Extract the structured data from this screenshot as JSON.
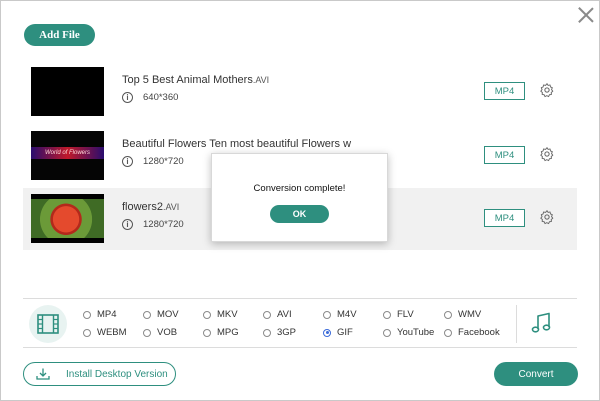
{
  "window": {
    "close_icon": "close-icon"
  },
  "toolbar": {
    "add_file_label": "Add File"
  },
  "files": [
    {
      "title": "Top 5 Best Animal Mothers",
      "ext": ".AVI",
      "resolution": "640*360",
      "format": "MP4"
    },
    {
      "title": "Beautiful Flowers   Ten most beautiful Flowers w",
      "ext": "",
      "resolution": "1280*720",
      "format": "MP4",
      "thumb_text": "World of Flowers"
    },
    {
      "title": "flowers2",
      "ext": ".AVI",
      "resolution": "1280*720",
      "format": "MP4"
    }
  ],
  "dialog": {
    "message": "Conversion complete!",
    "ok_label": "OK"
  },
  "formats": {
    "row1": [
      "MP4",
      "MOV",
      "MKV",
      "AVI",
      "M4V",
      "FLV",
      "WMV"
    ],
    "row2": [
      "WEBM",
      "VOB",
      "MPG",
      "3GP",
      "GIF",
      "YouTube",
      "Facebook"
    ],
    "selected": "GIF"
  },
  "footer": {
    "install_label": "Install Desktop Version",
    "convert_label": "Convert"
  },
  "colors": {
    "accent": "#2e8f7f",
    "radio_selected": "#3a6ad9"
  }
}
